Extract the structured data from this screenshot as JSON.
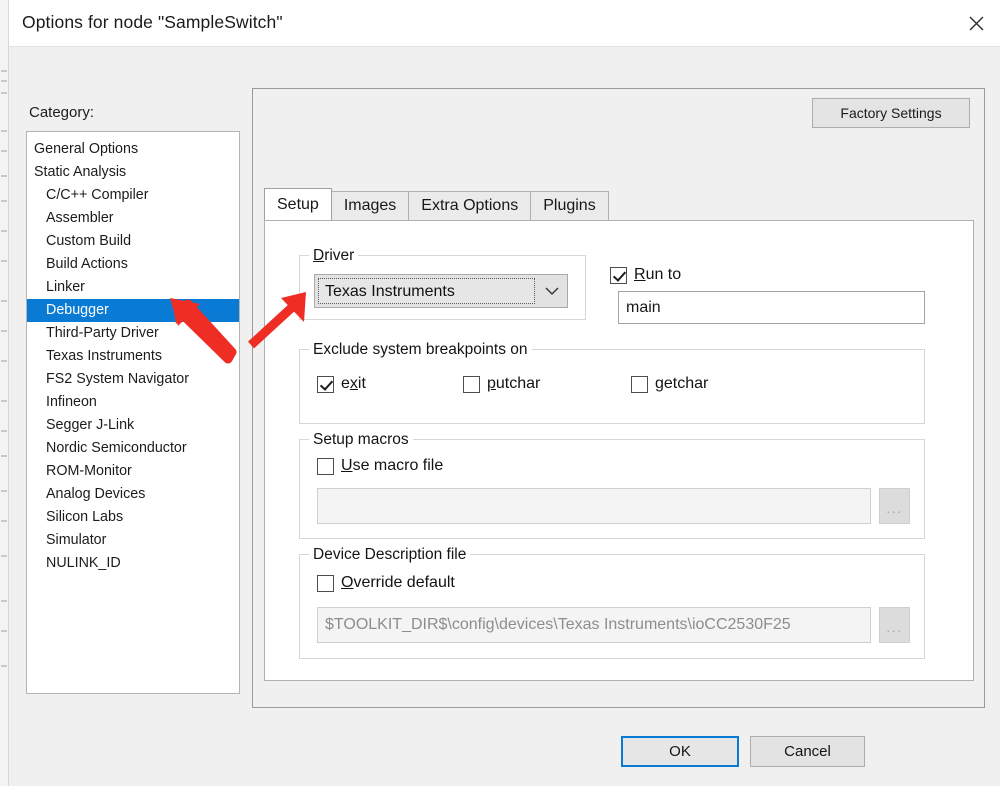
{
  "window": {
    "title": "Options for node \"SampleSwitch\"",
    "close_icon": "close-icon"
  },
  "category": {
    "label": "Category:",
    "items": [
      {
        "label": "General Options",
        "indent": false,
        "selected": false
      },
      {
        "label": "Static Analysis",
        "indent": false,
        "selected": false
      },
      {
        "label": "C/C++ Compiler",
        "indent": true,
        "selected": false
      },
      {
        "label": "Assembler",
        "indent": true,
        "selected": false
      },
      {
        "label": "Custom Build",
        "indent": true,
        "selected": false
      },
      {
        "label": "Build Actions",
        "indent": true,
        "selected": false
      },
      {
        "label": "Linker",
        "indent": true,
        "selected": false
      },
      {
        "label": "Debugger",
        "indent": true,
        "selected": true
      },
      {
        "label": "Third-Party Driver",
        "indent": true,
        "selected": false
      },
      {
        "label": "Texas Instruments",
        "indent": true,
        "selected": false
      },
      {
        "label": "FS2 System Navigator",
        "indent": true,
        "selected": false
      },
      {
        "label": "Infineon",
        "indent": true,
        "selected": false
      },
      {
        "label": "Segger J-Link",
        "indent": true,
        "selected": false
      },
      {
        "label": "Nordic Semiconductor",
        "indent": true,
        "selected": false
      },
      {
        "label": "ROM-Monitor",
        "indent": true,
        "selected": false
      },
      {
        "label": "Analog Devices",
        "indent": true,
        "selected": false
      },
      {
        "label": "Silicon Labs",
        "indent": true,
        "selected": false
      },
      {
        "label": "Simulator",
        "indent": true,
        "selected": false
      },
      {
        "label": "NULINK_ID",
        "indent": true,
        "selected": false
      }
    ]
  },
  "panel": {
    "factory_settings_label": "Factory Settings",
    "tabs": [
      {
        "label": "Setup",
        "active": true
      },
      {
        "label": "Images",
        "active": false
      },
      {
        "label": "Extra Options",
        "active": false
      },
      {
        "label": "Plugins",
        "active": false
      }
    ]
  },
  "setup": {
    "driver": {
      "legend_pre": "D",
      "legend_post": "river",
      "selected_value": "Texas Instruments",
      "dropdown_icon": "chevron-down-icon"
    },
    "run_to": {
      "label_pre": "R",
      "label_post": "un to",
      "checked": true,
      "value": "main"
    },
    "exclude_breakpoints": {
      "legend": "Exclude system breakpoints on",
      "options": [
        {
          "pre": "e",
          "accel": "x",
          "post": "it",
          "checked": true
        },
        {
          "pre": "",
          "accel": "p",
          "post": "utchar",
          "checked": false
        },
        {
          "pre": "",
          "accel": "g",
          "post": "etchar",
          "checked": false
        }
      ]
    },
    "setup_macros": {
      "legend": "Setup macros",
      "use_macro_file": {
        "accel": "U",
        "post": "se macro file",
        "checked": false
      },
      "macro_path_value": "",
      "browse_label": "..."
    },
    "device_description": {
      "legend": "Device Description file",
      "override_default": {
        "accel": "O",
        "post": "verride default",
        "checked": false
      },
      "path_value": "$TOOLKIT_DIR$\\config\\devices\\Texas Instruments\\ioCC2530F25",
      "browse_label": "..."
    }
  },
  "footer": {
    "ok_label": "OK",
    "cancel_label": "Cancel"
  },
  "annotations": {
    "accent_color": "#ee2d24",
    "arrow_1_target": "Debugger category item",
    "arrow_2_target": "Driver combo box"
  }
}
